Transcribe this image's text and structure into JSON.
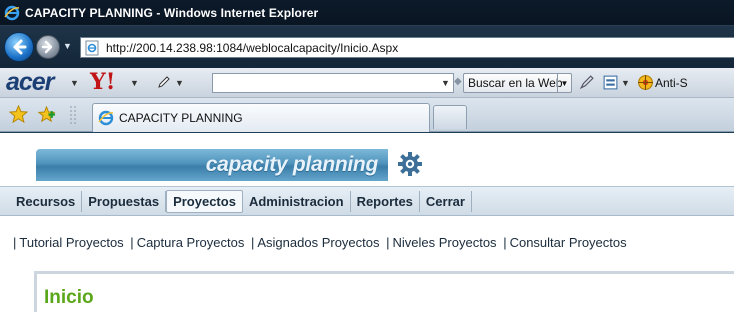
{
  "window": {
    "title": "CAPACITY PLANNING - Windows Internet Explorer",
    "url": "http://200.14.238.98:1084/weblocalcapacity/Inicio.Aspx"
  },
  "toolbar": {
    "brand": "acer",
    "yahoo_label": "Y!",
    "search_button_label": "Buscar en la Web",
    "antispy_label": "Anti-S",
    "search_value": ""
  },
  "tabs": [
    {
      "label": "CAPACITY PLANNING"
    }
  ],
  "app": {
    "logo_text": "capacity planning",
    "menu": [
      {
        "label": "Recursos"
      },
      {
        "label": "Propuestas"
      },
      {
        "label": "Proyectos",
        "active": true
      },
      {
        "label": "Administracion"
      },
      {
        "label": "Reportes"
      },
      {
        "label": "Cerrar"
      }
    ],
    "submenu": [
      {
        "label": "Tutorial Proyectos"
      },
      {
        "label": "Captura Proyectos"
      },
      {
        "label": "Asignados Proyectos"
      },
      {
        "label": "Niveles Proyectos"
      },
      {
        "label": "Consultar Proyectos"
      }
    ],
    "page_heading": "Inicio"
  },
  "colors": {
    "heading": "#5ba71c",
    "logo_bar": "#4f93bd",
    "title_bar": "#0c1a2a"
  }
}
